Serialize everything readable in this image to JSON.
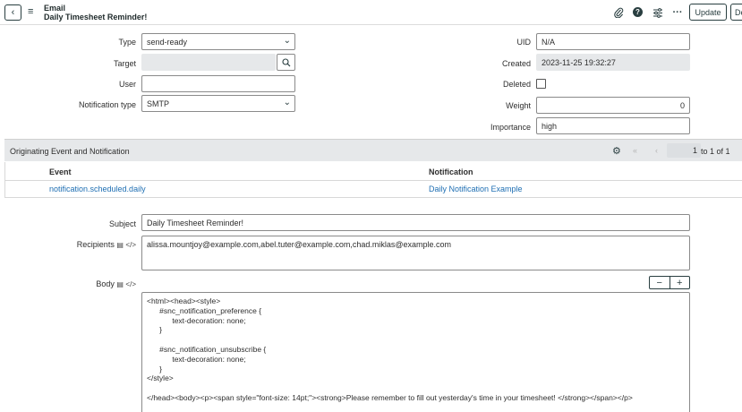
{
  "header": {
    "type_label": "Email",
    "record_title": "Daily Timesheet Reminder!",
    "update_label": "Update",
    "delete_label": "De",
    "more_label": "···"
  },
  "form": {
    "type": {
      "label": "Type",
      "value": "send-ready"
    },
    "target": {
      "label": "Target",
      "value": ""
    },
    "user": {
      "label": "User",
      "value": ""
    },
    "notification_type": {
      "label": "Notification type",
      "value": "SMTP"
    },
    "uid": {
      "label": "UID",
      "value": "N/A"
    },
    "created": {
      "label": "Created",
      "value": "2023-11-25 19:32:27"
    },
    "deleted": {
      "label": "Deleted",
      "checked": false
    },
    "weight": {
      "label": "Weight",
      "value": "0"
    },
    "importance": {
      "label": "Importance",
      "value": "high"
    }
  },
  "related_list": {
    "title": "Originating Event and Notification",
    "page_current": "1",
    "page_range": "to 1 of 1",
    "columns": [
      "Event",
      "Notification"
    ],
    "rows": [
      {
        "event": "notification.scheduled.daily",
        "notification": "Daily Notification Example"
      }
    ]
  },
  "email": {
    "subject": {
      "label": "Subject",
      "value": "Daily Timesheet Reminder!"
    },
    "recipients": {
      "label": "Recipients",
      "value": "alissa.mountjoy@example.com,abel.tuter@example.com,chad.miklas@example.com"
    },
    "body": {
      "label": "Body",
      "lines": [
        "<html><head><style>",
        "      #snc_notification_preference {",
        "            text-decoration: none;",
        "      }",
        "",
        "      #snc_notification_unsubscribe {",
        "            text-decoration: none;",
        "      }",
        "</style>",
        "",
        "</head><body><p><span style=\"font-size: 14pt;\"><strong>Please remember to fill out yesterday's time in your timesheet! </strong></span></p>"
      ]
    }
  },
  "colors": {
    "accent": "#293e40",
    "link": "#1f6fb3",
    "readonly_bg": "#e6e8ea"
  }
}
